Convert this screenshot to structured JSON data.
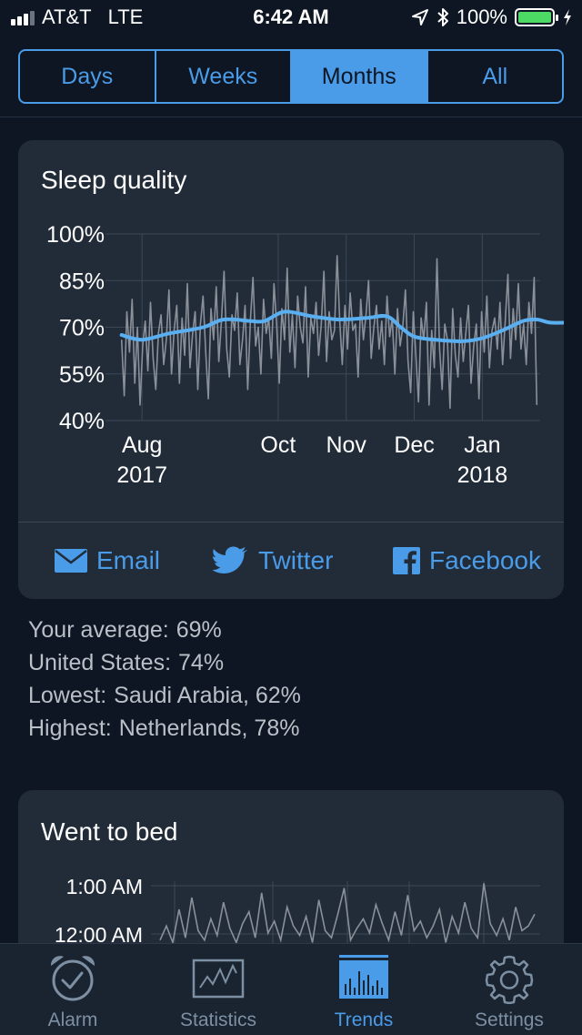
{
  "status_bar": {
    "carrier": "AT&T",
    "network": "LTE",
    "time": "6:42 AM",
    "battery": "100%"
  },
  "segments": [
    {
      "label": "Days",
      "selected": false
    },
    {
      "label": "Weeks",
      "selected": false
    },
    {
      "label": "Months",
      "selected": true
    },
    {
      "label": "All",
      "selected": false
    }
  ],
  "sleep_card": {
    "title": "Sleep quality",
    "share": {
      "email": "Email",
      "twitter": "Twitter",
      "facebook": "Facebook"
    }
  },
  "stats": {
    "average_label": "Your average:",
    "average_value": "69%",
    "country_label": "United States:",
    "country_value": "74%",
    "lowest_label": "Lowest:",
    "lowest_value": "Saudi Arabia, 62%",
    "highest_label": "Highest:",
    "highest_value": "Netherlands, 78%"
  },
  "bed_card": {
    "title": "Went to bed"
  },
  "tabs": [
    {
      "label": "Alarm",
      "icon": "alarm-clock-icon",
      "selected": false
    },
    {
      "label": "Statistics",
      "icon": "statistics-chart-icon",
      "selected": false
    },
    {
      "label": "Trends",
      "icon": "trends-bars-icon",
      "selected": true
    },
    {
      "label": "Settings",
      "icon": "gear-icon",
      "selected": false
    }
  ],
  "colors": {
    "accent": "#4a9be8",
    "trend_line": "#5aaff0",
    "raw_line": "#8a9099",
    "background": "#0d1622",
    "card": "#222c39"
  },
  "chart_data": [
    {
      "type": "line",
      "title": "Sleep quality",
      "y_ticks": [
        "100%",
        "85%",
        "70%",
        "55%",
        "40%"
      ],
      "ylim": [
        40,
        100
      ],
      "x_ticks": [
        {
          "month": "Aug",
          "year": "2017",
          "month_index": 0
        },
        {
          "month": "Oct",
          "year": "",
          "month_index": 2
        },
        {
          "month": "Nov",
          "year": "",
          "month_index": 3
        },
        {
          "month": "Dec",
          "year": "",
          "month_index": 4
        },
        {
          "month": "Jan",
          "year": "2018",
          "month_index": 5
        }
      ],
      "xlim_months": [
        -0.35,
        5.85
      ],
      "grid": true,
      "series": [
        {
          "role": "raw",
          "values": [
            66,
            48,
            75,
            62,
            79,
            52,
            70,
            45,
            64,
            72,
            56,
            78,
            60,
            50,
            68,
            74,
            58,
            66,
            82,
            55,
            69,
            77,
            52,
            73,
            61,
            84,
            57,
            68,
            75,
            50,
            71,
            80,
            62,
            47,
            76,
            66,
            83,
            59,
            72,
            88,
            63,
            54,
            74,
            69,
            81,
            58,
            66,
            77,
            50,
            72,
            86,
            64,
            70,
            55,
            79,
            68,
            73,
            60,
            84,
            71,
            52,
            76,
            66,
            89,
            62,
            74,
            57,
            80,
            70,
            65,
            83,
            54,
            73,
            68,
            78,
            61,
            71,
            88,
            59,
            75,
            66,
            69,
            93,
            72,
            58,
            77,
            63,
            81,
            69,
            71,
            54,
            79,
            66,
            74,
            85,
            60,
            70,
            77,
            63,
            72,
            58,
            80,
            67,
            73,
            55,
            76,
            64,
            70,
            82,
            59,
            49,
            75,
            61,
            46,
            73,
            66,
            78,
            45,
            69,
            57,
            92,
            63,
            50,
            71,
            66,
            44,
            76,
            61,
            54,
            73,
            59,
            68,
            77,
            52,
            64,
            71,
            47,
            75,
            62,
            80,
            57,
            69,
            73,
            63,
            78,
            58,
            72,
            87,
            60,
            76,
            66,
            84,
            63,
            71,
            58,
            78,
            68,
            86,
            45
          ],
          "x_start_month": -0.3,
          "x_end_month": 5.8
        },
        {
          "role": "trend",
          "points": [
            [
              -0.3,
              67.5
            ],
            [
              0.0,
              66.0
            ],
            [
              0.4,
              68.0
            ],
            [
              0.9,
              70.0
            ],
            [
              1.2,
              72.5
            ],
            [
              1.6,
              72.0
            ],
            [
              1.8,
              72.0
            ],
            [
              2.1,
              75.0
            ],
            [
              2.5,
              73.5
            ],
            [
              2.9,
              72.5
            ],
            [
              3.3,
              73.0
            ],
            [
              3.6,
              73.5
            ],
            [
              3.8,
              70.0
            ],
            [
              4.0,
              67.0
            ],
            [
              4.3,
              66.0
            ],
            [
              4.7,
              65.5
            ],
            [
              5.0,
              66.5
            ],
            [
              5.3,
              69.0
            ],
            [
              5.6,
              72.0
            ],
            [
              5.8,
              72.5
            ],
            [
              6.0,
              71.5
            ],
            [
              6.3,
              71.5
            ],
            [
              6.5,
              71.5
            ]
          ]
        }
      ]
    },
    {
      "type": "line",
      "title": "Went to bed",
      "y_ticks": [
        "1:00 AM",
        "12:00 AM"
      ],
      "grid": true,
      "series": [
        {
          "role": "raw",
          "values": [
            2,
            8,
            1,
            15,
            3,
            20,
            6,
            2,
            11,
            4,
            18,
            7,
            1,
            9,
            14,
            3,
            22,
            5,
            10,
            2,
            16,
            8,
            4,
            12,
            1,
            19,
            6,
            3,
            13,
            24,
            2,
            7,
            11,
            5,
            17,
            9,
            2,
            14,
            4,
            21,
            6,
            10,
            3,
            8,
            15,
            1,
            12,
            5,
            18,
            7,
            3,
            26,
            9,
            4,
            11,
            2,
            16,
            6,
            8,
            13
          ]
        }
      ]
    }
  ]
}
